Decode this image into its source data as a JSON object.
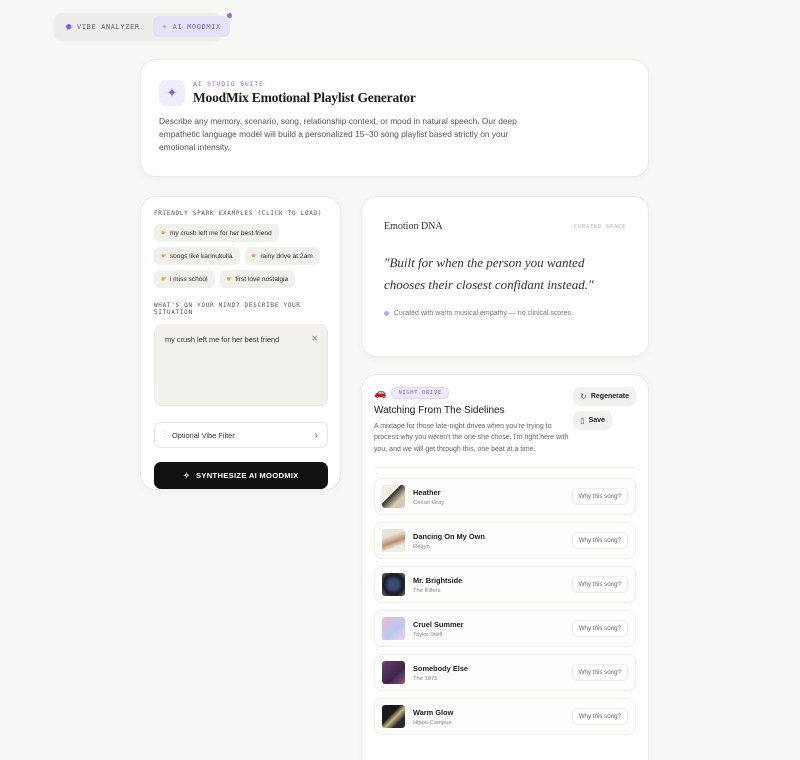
{
  "mode_switch": {
    "tabs": [
      {
        "label": "VIBE ANALYZER",
        "icon": "brain-icon"
      },
      {
        "label": "AI MOODMIX",
        "icon": "sparkle-icon"
      }
    ],
    "active": "AI MOODMIX"
  },
  "header": {
    "eyebrow": "AI STUDIO SUITE",
    "title": "MoodMix Emotional Playlist Generator",
    "description": "Describe any memory, scenario, song, relationship context, or mood in natural speech. Our deep empathetic language model will build a personalized 15–30 song playlist based strictly on your emotional intensity."
  },
  "input_panel": {
    "examples_label": "FRIENDLY SPARK EXAMPLES (CLICK TO LOAD)",
    "examples": [
      "my crush left me for her best friend",
      "songs like kannukulla",
      "rainy drive at 2am",
      "i miss school",
      "first love nostalgia"
    ],
    "situation_label": "WHAT'S ON YOUR MIND? DESCRIBE YOUR SITUATION",
    "situation_value": "my crush left me for her best friend",
    "vibe_filter_label": "Optional Vibe Filter",
    "synthesize_label": "SYNTHESIZE AI MOODMIX"
  },
  "emotion_dna": {
    "title": "Emotion DNA",
    "tag": "CURATED SPACE",
    "quote": "\"Built for when the person you wanted chooses their closest confidant instead.\"",
    "note": "Curated with warm musical empathy — no clinical scores."
  },
  "playlist": {
    "tag": "NIGHT DRIVE",
    "title": "Watching From The Sidelines",
    "description": "A mixtape for those late-night drives when you're trying to process why you weren't the one she chose. I'm right here with you, and we will get through this, one beat at a time.",
    "regenerate_label": "Regenerate",
    "save_label": "Save",
    "why_label": "Why this song?",
    "songs": [
      {
        "title": "Heather",
        "artist": "Conan Gray"
      },
      {
        "title": "Dancing On My Own",
        "artist": "Robyn"
      },
      {
        "title": "Mr. Brightside",
        "artist": "The Killers"
      },
      {
        "title": "Cruel Summer",
        "artist": "Taylor Swift"
      },
      {
        "title": "Somebody Else",
        "artist": "The 1975"
      },
      {
        "title": "Warm Glow",
        "artist": "Hippo Campus"
      }
    ]
  },
  "colors": {
    "accent": "#8b6cf0",
    "primary_button": "#111111",
    "background": "#f7f7f6"
  }
}
